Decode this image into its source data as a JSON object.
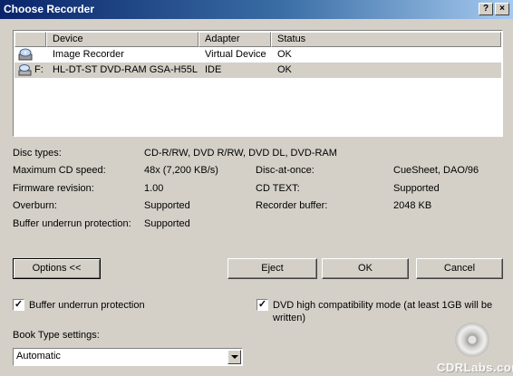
{
  "window": {
    "title": "Choose Recorder",
    "help_button": "?",
    "close_button": "×"
  },
  "device_list": {
    "columns": [
      "Device",
      "Adapter",
      "Status"
    ],
    "rows": [
      {
        "letter": "",
        "icon": "image-recorder-icon",
        "device": "Image Recorder",
        "adapter": "Virtual Device",
        "status": "OK",
        "selected": false
      },
      {
        "letter": "F:",
        "icon": "optical-drive-icon",
        "device": "HL-DT-ST DVD-RAM GSA-H55L",
        "adapter": "IDE",
        "status": "OK",
        "selected": true
      }
    ]
  },
  "info": {
    "disc_types_label": "Disc types:",
    "disc_types_value": "CD-R/RW, DVD R/RW, DVD DL, DVD-RAM",
    "max_speed_label": "Maximum CD speed:",
    "max_speed_value": "48x (7,200 KB/s)",
    "firmware_label": "Firmware revision:",
    "firmware_value": "1.00",
    "overburn_label": "Overburn:",
    "overburn_value": "Supported",
    "bup_label": "Buffer underrun protection:",
    "bup_value": "Supported",
    "dao_label": "Disc-at-once:",
    "dao_value": "CueSheet, DAO/96",
    "cdtext_label": "CD TEXT:",
    "cdtext_value": "Supported",
    "recbuf_label": "Recorder buffer:",
    "recbuf_value": "2048 KB"
  },
  "buttons": {
    "options": "Options <<",
    "eject": "Eject",
    "ok": "OK",
    "cancel": "Cancel"
  },
  "options": {
    "buffer_underrun_label": "Buffer underrun protection",
    "buffer_underrun_checked": true,
    "dvd_compat_label_line1": "DVD high compatibility mode (at least 1GB will be",
    "dvd_compat_label_line2": "written)",
    "dvd_compat_checked": true,
    "book_type_label": "Book Type settings:",
    "book_type_value": "Automatic"
  },
  "watermark": "CDRLabs.com"
}
